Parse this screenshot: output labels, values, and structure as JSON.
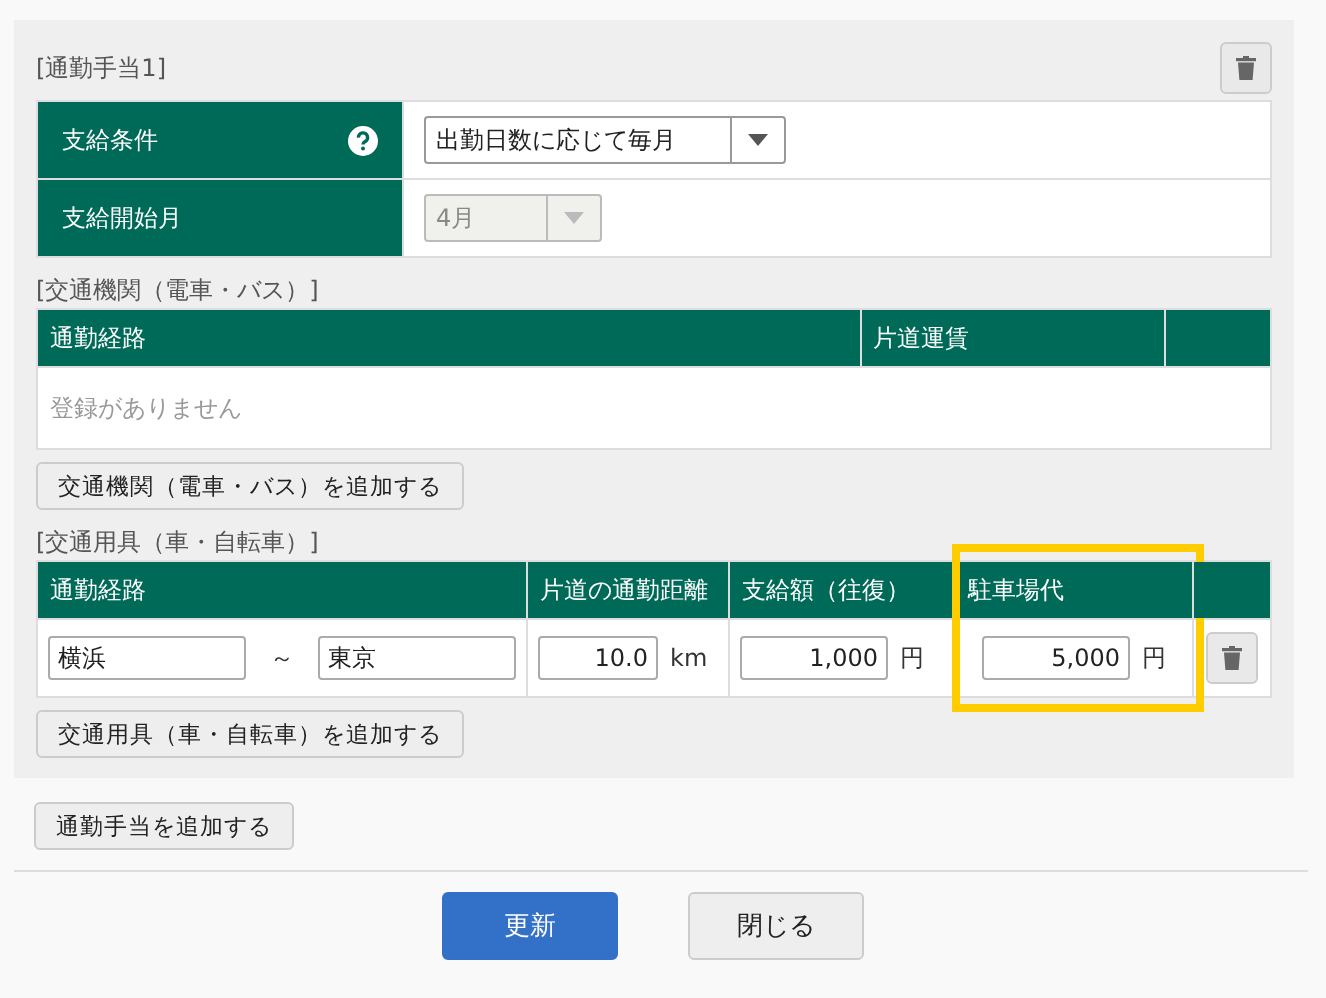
{
  "allowance": {
    "title": "[通勤手当1]",
    "conditions": [
      {
        "label": "支給条件",
        "help": true,
        "value": "出勤日数に応じて毎月",
        "disabled": false
      },
      {
        "label": "支給開始月",
        "help": false,
        "value": "4月",
        "disabled": true
      }
    ],
    "transit": {
      "title": "[交通機関（電車・バス）]",
      "columns": [
        {
          "label": "通勤経路",
          "highlighted": false
        },
        {
          "label": "片道運賃",
          "highlighted": false
        }
      ],
      "empty": "登録がありません",
      "add_button": "交通機関（電車・バス）を追加する"
    },
    "vehicle": {
      "title": "[交通用具（車・自転車）]",
      "columns": [
        {
          "label": "通勤経路",
          "highlighted": false
        },
        {
          "label": "片道の通勤距離",
          "highlighted": false
        },
        {
          "label": "支給額（往復）",
          "highlighted": false
        },
        {
          "label": "駐車場代",
          "highlighted": true
        }
      ],
      "rows": [
        {
          "from": "横浜",
          "separator": "～",
          "to": "東京",
          "distance": "10.0",
          "distance_unit": "km",
          "amount": "1,000",
          "amount_unit": "円",
          "parking": "5,000",
          "parking_unit": "円"
        }
      ],
      "add_button": "交通用具（車・自転車）を追加する"
    }
  },
  "add_allowance_button": "通勤手当を追加する",
  "buttons": [
    {
      "label": "更新",
      "kind": "primary"
    },
    {
      "label": "閉じる",
      "kind": "secondary"
    }
  ]
}
